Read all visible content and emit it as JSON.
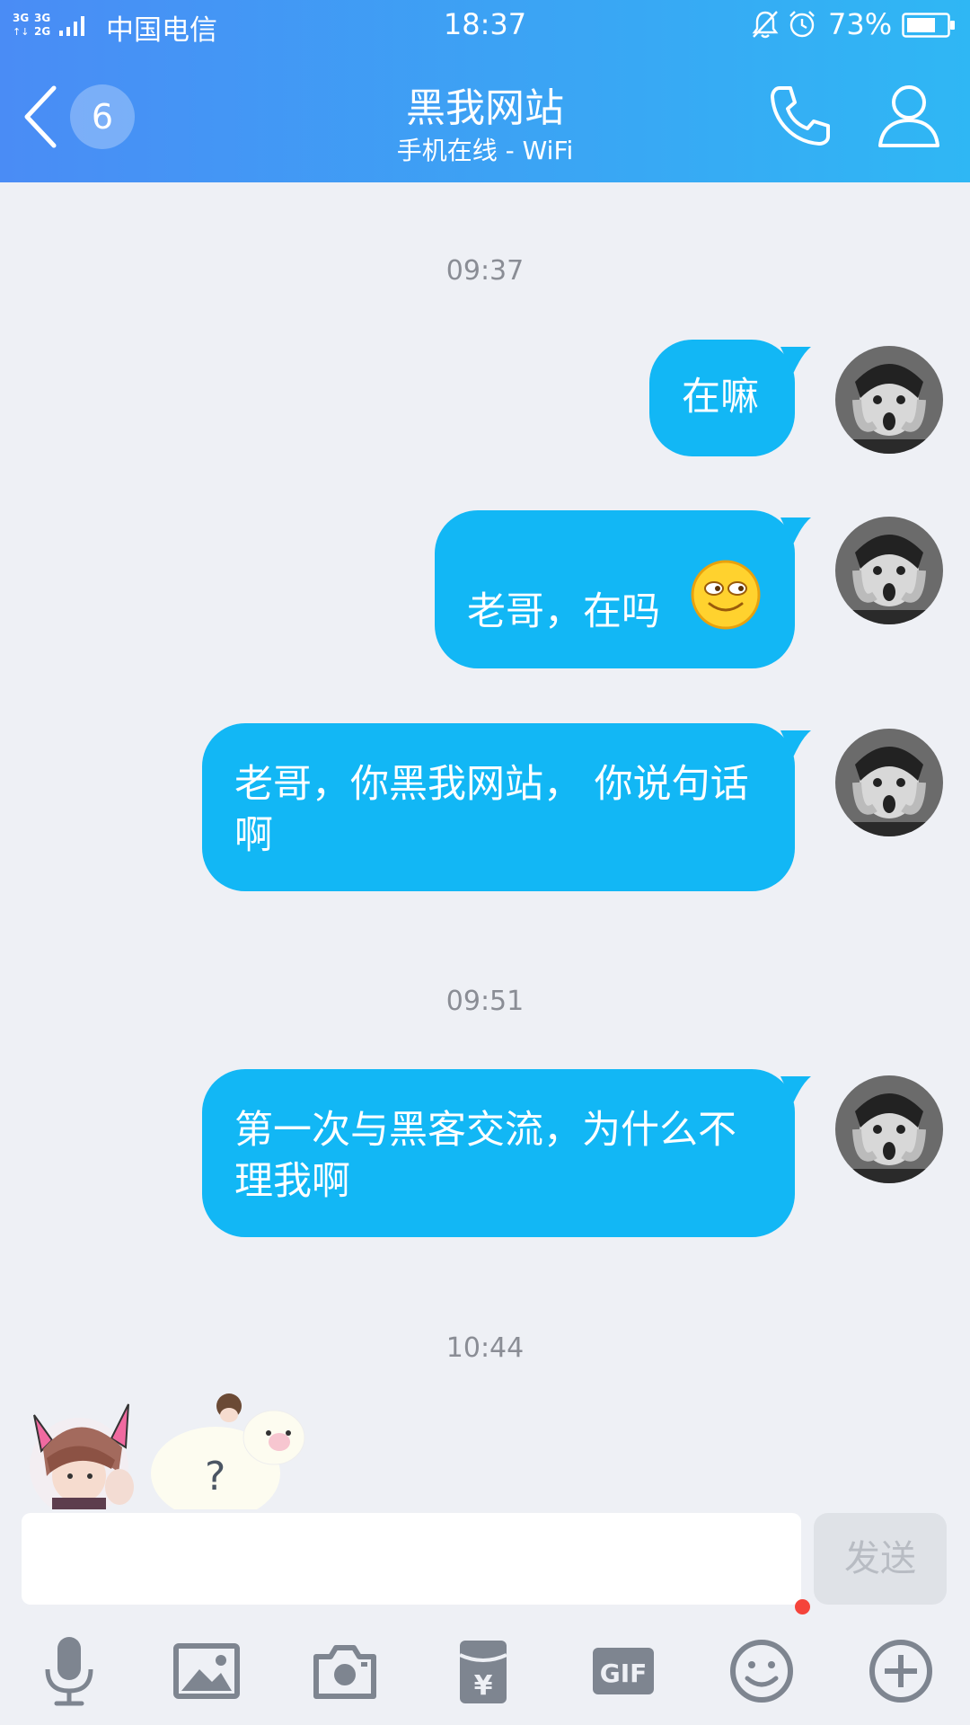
{
  "status_bar": {
    "network": "3G 3G 2G",
    "carrier": "中国电信",
    "time": "18:37",
    "battery": "73%"
  },
  "header": {
    "unread_count": "6",
    "title": "黑我网站",
    "subtitle": "手机在线 - WiFi"
  },
  "messages": [
    {
      "time": "09:37"
    },
    {
      "text": "在嘛"
    },
    {
      "text": "老哥，在吗",
      "emoji": "smiley-icon"
    },
    {
      "text": "老哥，你黑我网站， 你说句话啊"
    },
    {
      "time": "09:51"
    },
    {
      "text": "第一次与黑客交流，为什么不理我啊"
    },
    {
      "time": "10:44"
    },
    {
      "sticker_text": "?"
    }
  ],
  "input": {
    "placeholder": "",
    "send_label": "发送"
  },
  "toolbar": {
    "icons": [
      "mic-icon",
      "image-icon",
      "camera-icon",
      "red-packet-icon",
      "gif-icon",
      "emoji-icon",
      "plus-icon"
    ],
    "gif_label": "GIF",
    "yen_symbol": "¥"
  },
  "colors": {
    "header_start": "#4a8cf5",
    "header_end": "#2fb7f4",
    "bubble": "#12b7f5",
    "background": "#eef0f5",
    "notification_dot": "#f5443b"
  }
}
